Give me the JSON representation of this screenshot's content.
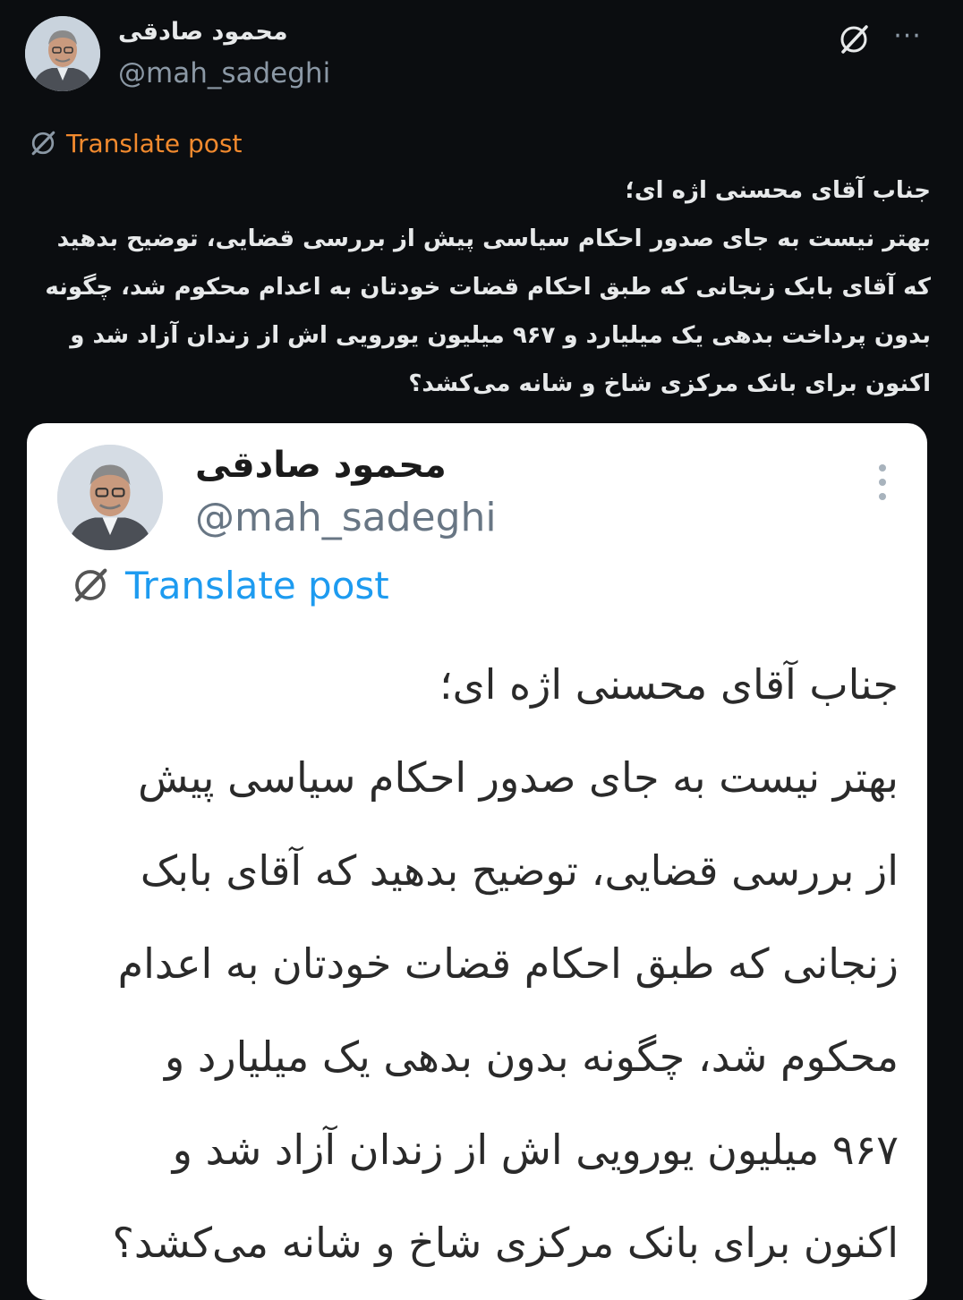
{
  "post": {
    "author_name": "محمود صادقی",
    "author_handle": "@mah_sadeghi",
    "grok_icon": "grok-slash-icon",
    "more_icon": "more-dots-icon",
    "more_label": "···",
    "translate_label": "Translate post",
    "text": "جناب آقای محسنی اژه ای؛\nبهتر نیست به جای صدور احکام سیاسی پیش از بررسی قضایی، توضیح بدهید که آقای بابک زنجانی که طبق احکام قضات خودتان به اعدام محکوم شد، چگونه بدون پرداخت بدهی یک میلیارد و ۹۶۷ میلیون یورویی اش از زندان آزاد شد و اکنون برای بانک مرکزی شاخ و شانه می‌کشد؟"
  },
  "embedded_image": {
    "author_name": "محمود صادقی",
    "author_handle": "@mah_sadeghi",
    "translate_label": "Translate post",
    "text": "جناب آقای محسنی اژه ای؛\nبهتر نیست به جای صدور احکام سیاسی پیش\nاز بررسی قضایی، توضیح بدهید که آقای بابک\nزنجانی که طبق احکام قضات خودتان به اعدام\nمحکوم شد، چگونه بدون بدهی یک میلیارد و\n۹۶۷ میلیون یورویی اش از زندان آزاد شد و\nاکنون برای بانک مرکزی شاخ و شانه می‌کشد؟"
  },
  "colors": {
    "background": "#0b0d10",
    "translate_orange": "#f28a2e",
    "translate_blue": "#1d9bf0",
    "handle_gray": "#8b98a5"
  }
}
